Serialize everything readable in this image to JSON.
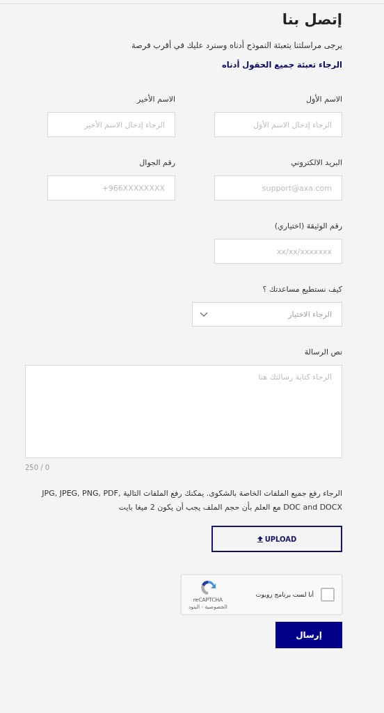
{
  "title": "إتصل بنا",
  "intro": "يرجى مراسلتنا بتعبئة النموذج أدناه وسنرد عليك في أقرب فرصة",
  "required_note": "الرجاء تعبئة جميع الحقول أدناه",
  "field_rows": [
    [
      {
        "label": "الاسم الأول",
        "placeholder": "الرجاء إدخال الاسم الأول"
      },
      {
        "label": "الاسم الأخير",
        "placeholder": "الرجاء إدخال الاسم الأخير"
      }
    ],
    [
      {
        "label": "البريد الالكتروني",
        "placeholder": "support@axa.com"
      },
      {
        "label": "رقم الجوال",
        "placeholder": "+966XXXXXXXX"
      }
    ],
    [
      {
        "label": "رقم الوثيقة (اختياري)",
        "placeholder": "xx/xx/xxxxxxx"
      }
    ]
  ],
  "help_select": {
    "label": "كيف نستطيع مساعدتك ؟",
    "placeholder": "الرجاء الاختيار"
  },
  "message": {
    "label": "نص الرسالة",
    "placeholder": "الرجاء كتابة رسالتك هنا",
    "counter": "250 / 0"
  },
  "upload_note": "الرجاء رفع جميع الملفات الخاصة بالشكوى. يمكنك رفع الملفات التالية JPG, JPEG, PNG, PDF, DOC and DOCX مع العلم بأن حجم الملف يجب أن يكون 2 ميغا بايت",
  "upload_button": "UPLOAD",
  "captcha": {
    "label": "أنا لست برنامج روبوت",
    "checked": false,
    "brand": "reCAPTCHA",
    "links": "الخصوصية - البنود"
  },
  "submit_button": "إرسال"
}
